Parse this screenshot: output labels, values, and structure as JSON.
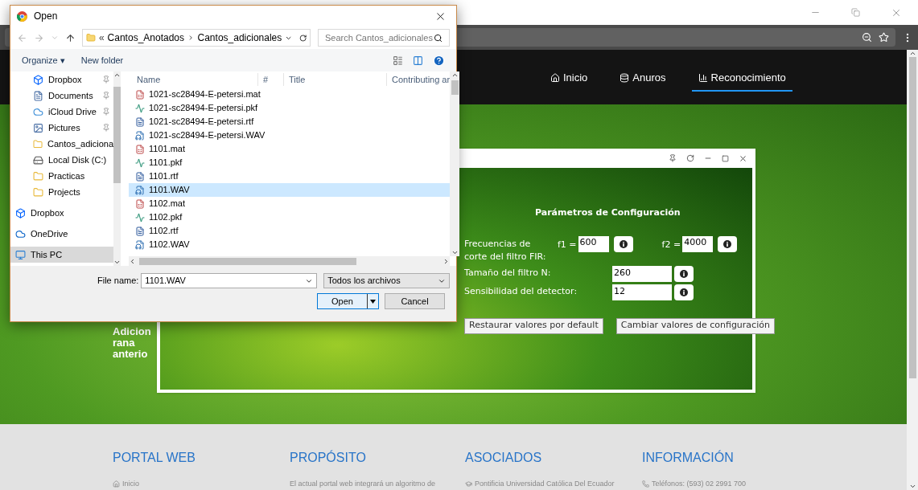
{
  "site": {
    "nav": [
      {
        "label": "Inicio",
        "kind": "home",
        "selected": false
      },
      {
        "label": "Anuros",
        "kind": "database",
        "selected": false
      },
      {
        "label": "Reconocimiento",
        "kind": "chart",
        "selected": true
      }
    ],
    "hero_lines": [
      "Adicion",
      "rana",
      "anterio"
    ],
    "footer": [
      {
        "heading": "PORTAL WEB",
        "kind": "home",
        "text": "Inicio"
      },
      {
        "heading": "PROPÓSITO",
        "kind": "none",
        "text": "El actual portal web integrará un algoritmo de"
      },
      {
        "heading": "ASOCIADOS",
        "kind": "cap",
        "text": "Pontificia Universidad Católica Del Ecuador"
      },
      {
        "heading": "INFORMACIÓN",
        "kind": "phone",
        "text": "Teléfonos: (593) 02 2991 700"
      }
    ]
  },
  "config": {
    "title": "Parámetros de Configuración",
    "freq_label": [
      "Frecuencias de",
      "corte del filtro FIR:"
    ],
    "f1_label": "f1 =",
    "f1_value": "600",
    "f2_label": "f2 =",
    "f2_value": "4000",
    "rows": [
      {
        "label": "Tamaño del filtro N:",
        "value": "260"
      },
      {
        "label": "Sensibilidad del detector:",
        "value": "12"
      }
    ],
    "buttons": [
      "Restaurar valores por default",
      "Cambiar valores de configuración"
    ]
  },
  "dialog": {
    "title": "Open",
    "path": [
      "«",
      "Cantos_Anotados",
      "Cantos_adicionales"
    ],
    "search": {
      "placeholder": "Search Cantos_adicionales"
    },
    "organize": "Organize ▾",
    "new_folder": "New folder",
    "nav": [
      {
        "label": "Dropbox",
        "kind": "dropbox",
        "pinned": true,
        "selected": false
      },
      {
        "label": "Documents",
        "kind": "documents",
        "pinned": true,
        "selected": false
      },
      {
        "label": "iCloud Drive",
        "kind": "cloud",
        "pinned": true,
        "selected": false
      },
      {
        "label": "Pictures",
        "kind": "pictures",
        "pinned": true,
        "selected": false
      },
      {
        "label": "Cantos_adiciona",
        "kind": "folder",
        "pinned": false,
        "selected": false
      },
      {
        "label": "Local Disk (C:)",
        "kind": "disk",
        "pinned": false,
        "selected": false
      },
      {
        "label": "Practicas",
        "kind": "folder",
        "pinned": false,
        "selected": false
      },
      {
        "label": "Projects",
        "kind": "folder",
        "pinned": false,
        "selected": false
      },
      {
        "label": "Dropbox",
        "kind": "dropbox",
        "pinned": false,
        "selected": false
      },
      {
        "label": "OneDrive",
        "kind": "onedrive",
        "pinned": false,
        "selected": false
      },
      {
        "label": "This PC",
        "kind": "pc",
        "pinned": false,
        "selected": true
      }
    ],
    "columns": [
      "Name",
      "#",
      "Title",
      "Contributing ar"
    ],
    "files": [
      {
        "name": "1021-sc28494-E-petersi.mat",
        "kind": "mat",
        "selected": false
      },
      {
        "name": "1021-sc28494-E-petersi.pkf",
        "kind": "pkf",
        "selected": false
      },
      {
        "name": "1021-sc28494-E-petersi.rtf",
        "kind": "rtf",
        "selected": false
      },
      {
        "name": "1021-sc28494-E-petersi.WAV",
        "kind": "wav",
        "selected": false
      },
      {
        "name": "1101.mat",
        "kind": "mat",
        "selected": false
      },
      {
        "name": "1101.pkf",
        "kind": "pkf",
        "selected": false
      },
      {
        "name": "1101.rtf",
        "kind": "rtf",
        "selected": false
      },
      {
        "name": "1101.WAV",
        "kind": "wav",
        "selected": true
      },
      {
        "name": "1102.mat",
        "kind": "mat",
        "selected": false
      },
      {
        "name": "1102.pkf",
        "kind": "pkf",
        "selected": false
      },
      {
        "name": "1102.rtf",
        "kind": "rtf",
        "selected": false
      },
      {
        "name": "1102.WAV",
        "kind": "wav",
        "selected": false
      }
    ],
    "file_name_label": "File name:",
    "file_name": "1101.WAV",
    "filter": "Todos los archivos",
    "open": "Open",
    "cancel": "Cancel"
  }
}
